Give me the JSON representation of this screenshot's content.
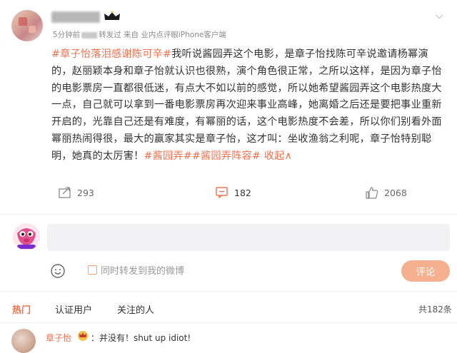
{
  "post": {
    "author": {
      "username_blurred": true,
      "badge_icon": "vip-crown-icon"
    },
    "meta": {
      "time_prefix": "5分钟前",
      "edited_label": "转发过",
      "source": "来自 业内点评眼iPhone客户端"
    },
    "body": {
      "tag_open": "#章子怡落泪感谢陈可辛#",
      "text": "我听说酱园弄这个电影，是章子怡找陈可辛说邀请杨幂演的，赵丽颖本身和章子怡就认识也很熟，演个角色很正常，之所以这样，是因为章子怡的电影票房一直都很低迷，有点大不如以前的感觉，所以她希望酱园弄这个电影热度大一点，自己就可以拿到一番电影票房再次迎来事业高峰，她离婚之后还是要把事业重新开启的，光靠自己还是有难度，有幂丽的话，这个电影热度不会差，所以你们别看外面幂丽热闹得很，最大的赢家其实是章子怡，这才叫：坐收渔翁之利呢，章子怡特别聪明，她真的太厉害！",
      "tag_close_1": "#酱园弄#",
      "tag_close_2": "#酱园弄阵容#",
      "collapse": "收起∧"
    },
    "actions": {
      "reposts": "293",
      "comments": "182",
      "likes": "2068"
    }
  },
  "composer": {
    "forward_label": "同时转发到我的微博",
    "submit": "评论"
  },
  "tabs": [
    {
      "label": "热门",
      "active": true
    },
    {
      "label": "认证用户",
      "active": false
    },
    {
      "label": "关注的人",
      "active": false
    }
  ],
  "comment_count": "共182条",
  "comments": [
    {
      "name": "章子怡",
      "text": "：并没有！shut up idiot!"
    }
  ],
  "colors": {
    "accent": "#eb7350",
    "button": "#f5b08f",
    "input_bg": "#f2f2f5"
  }
}
